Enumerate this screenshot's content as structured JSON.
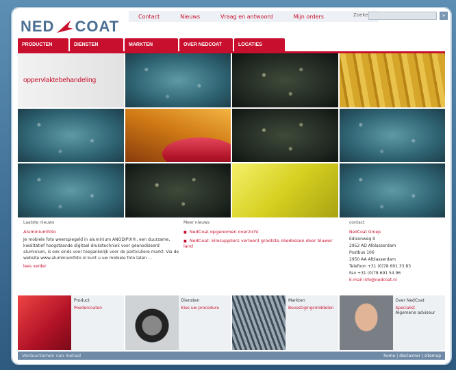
{
  "header": {
    "logo_left": "NED",
    "logo_right": "COAT",
    "toplinks": [
      "Contact",
      "Nieuws",
      "Vraag en antwoord",
      "Mijn orders"
    ],
    "search_label": "Zoeken:",
    "search_placeholder": "",
    "search_button": "»"
  },
  "nav": {
    "items": [
      "PRODUCTEN",
      "DIENSTEN",
      "MARKTEN",
      "OVER NEDCOAT",
      "LOCATIES"
    ]
  },
  "hero": {
    "caption": "oppervlaktebehandeling"
  },
  "news": {
    "heading": "Laatste nieuws",
    "title": "Aluminiumfoto",
    "body": "Je mobiele foto weerspiegeld in aluminium ANODIPIX®, een duurzame, kwalitatief hoogstaande digitaal drukstechniek voor geanodiseerd aluminium, is ook sinds voor toegankelijk voor de particuliere markt. Via de website www.aluminiumfoto.nl kunt u uw mobiele foto laten ...",
    "more": "lees verder"
  },
  "more_news": {
    "heading": "Meer nieuws",
    "items": [
      "NedCoat opgenomen overzicht",
      "NedCoat: kilosuppliers verleent grootste oliedossen door bluwer land"
    ]
  },
  "contact": {
    "heading": "contact",
    "company": "NedCoat Groep",
    "lines": [
      "Edisonweg 9",
      "2952 AD Alblasserdam",
      "Postbus 106",
      "2950 AA Alblasserdam"
    ],
    "phone": "Telefoon   +31 (0)78 691 33 83",
    "fax": "Fax          +31 (0)78 691 54 96",
    "email": "E-mail    info@nedcoat.nl"
  },
  "cards": [
    {
      "title": "Product",
      "link": "Poedercoaten"
    },
    {
      "title": "Diensten",
      "link": "Kies uw procedure"
    },
    {
      "title": "Markten",
      "link": "Bevestigingsmiddelen"
    },
    {
      "title": "Over NedCoat",
      "link": "Specialist",
      "sub": "Algemene adviseur"
    }
  ],
  "footer": {
    "left": "Verduurzamen van metaal",
    "right": "home | disclaimer | sitemap"
  },
  "colors": {
    "brand_red": "#c8102e",
    "logo_blue": "#4a6e92",
    "background_blue": "#3f6e95"
  }
}
